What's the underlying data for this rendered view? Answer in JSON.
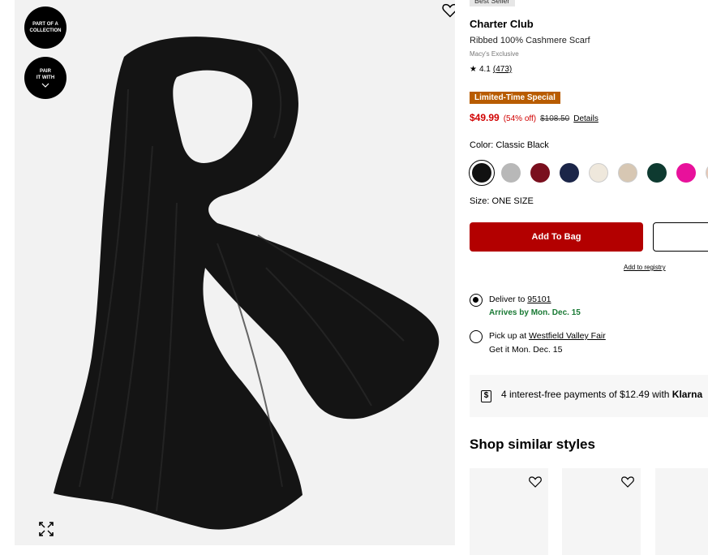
{
  "gallery": {
    "badges": [
      {
        "line1": "PART OF A",
        "line2": "COLLECTION"
      },
      {
        "line1": "PAIR",
        "line2": "IT WITH"
      }
    ]
  },
  "product": {
    "best_seller": "Best Seller",
    "brand": "Charter Club",
    "name": "Ribbed 100% Cashmere Scarf",
    "exclusive": "Macy's Exclusive",
    "rating": "4.1",
    "review_count": "(473)",
    "special_label": "Limited-Time Special",
    "price_now": "$49.99",
    "price_off": "(54% off)",
    "price_was": "$108.50",
    "details_link": "Details",
    "color_label": "Color: Classic Black",
    "swatches": [
      {
        "name": "Classic Black",
        "hex": "#111111"
      },
      {
        "name": "Grey",
        "hex": "#b8b8b8"
      },
      {
        "name": "Burgundy",
        "hex": "#7a0f1e"
      },
      {
        "name": "Navy",
        "hex": "#1b2548"
      },
      {
        "name": "Ivory",
        "hex": "#efe8dc"
      },
      {
        "name": "Oatmeal",
        "hex": "#d7c7b3"
      },
      {
        "name": "Forest Green",
        "hex": "#0e3a30"
      },
      {
        "name": "Pink",
        "hex": "#e8119b"
      },
      {
        "name": "Blush",
        "hex": "#e8c9b8"
      }
    ],
    "size_label": "Size: ONE SIZE",
    "add_to_bag": "Add To Bag",
    "add_to_registry": "Add to registry"
  },
  "fulfillment": {
    "deliver_prefix": "Deliver to ",
    "deliver_zip": "95101",
    "deliver_eta": "Arrives by Mon. Dec. 15",
    "pickup_prefix": "Pick up at ",
    "pickup_store": "Westfield Valley Fair",
    "pickup_eta": "Get it Mon. Dec. 15"
  },
  "klarna": {
    "text": "4 interest-free payments of $12.49 with ",
    "brand": "Klarna"
  },
  "similar": {
    "title": "Shop similar styles"
  },
  "colors": {
    "accent_red": "#b30000",
    "sale_red": "#d10000",
    "special_orange": "#b85c00",
    "eta_green": "#1a7a35"
  }
}
